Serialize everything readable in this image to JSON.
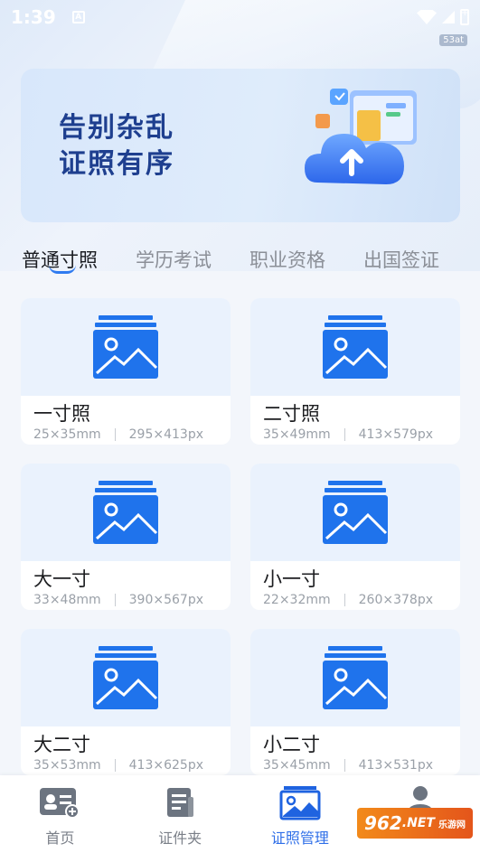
{
  "status_bar": {
    "time": "1:39",
    "indicator": "A",
    "badge": "53at"
  },
  "banner": {
    "line1": "告别杂乱",
    "line2": "证照有序"
  },
  "tabs": [
    {
      "label": "普通寸照",
      "active": true
    },
    {
      "label": "学历考试",
      "active": false
    },
    {
      "label": "职业资格",
      "active": false
    },
    {
      "label": "出国签证",
      "active": false
    }
  ],
  "cards": [
    {
      "name": "一寸照",
      "mm": "25×35mm",
      "px": "295×413px"
    },
    {
      "name": "二寸照",
      "mm": "35×49mm",
      "px": "413×579px"
    },
    {
      "name": "大一寸",
      "mm": "33×48mm",
      "px": "390×567px"
    },
    {
      "name": "小一寸",
      "mm": "22×32mm",
      "px": "260×378px"
    },
    {
      "name": "大二寸",
      "mm": "35×53mm",
      "px": "413×625px"
    },
    {
      "name": "小二寸",
      "mm": "35×45mm",
      "px": "413×531px"
    }
  ],
  "bottom_nav": [
    {
      "label": "首页",
      "icon": "id-card-icon",
      "active": false
    },
    {
      "label": "证件夹",
      "icon": "document-icon",
      "active": false
    },
    {
      "label": "证照管理",
      "icon": "photo-stack-icon",
      "active": true
    },
    {
      "label": "",
      "icon": "user-icon",
      "active": false
    }
  ],
  "watermark": {
    "brand": "962",
    "suffix": ".NET",
    "sub": "乐游网"
  },
  "colors": {
    "accent": "#2f7bf0",
    "banner_text": "#1e3f8f",
    "thumb_bg": "#eaf2fd"
  }
}
